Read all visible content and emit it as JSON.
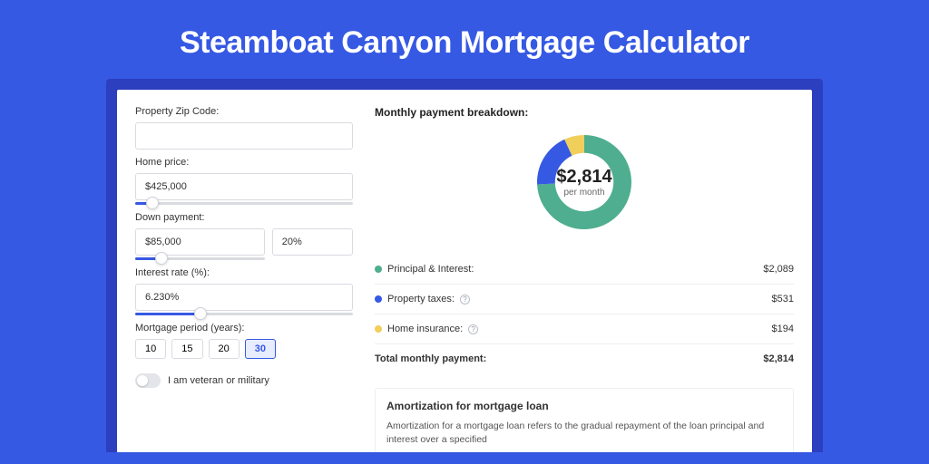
{
  "title": "Steamboat Canyon Mortgage Calculator",
  "form": {
    "zip_label": "Property Zip Code:",
    "zip_value": "",
    "home_price_label": "Home price:",
    "home_price_value": "$425,000",
    "down_payment_label": "Down payment:",
    "down_payment_value": "$85,000",
    "down_payment_pct": "20%",
    "rate_label": "Interest rate (%):",
    "rate_value": "6.230%",
    "period_label": "Mortgage period (years):",
    "periods": [
      "10",
      "15",
      "20",
      "30"
    ],
    "period_selected_index": 3,
    "veteran_label": "I am veteran or military",
    "sliders": {
      "home_price_pct": 8,
      "down_payment_pct": 20,
      "rate_pct": 30
    }
  },
  "breakdown": {
    "title": "Monthly payment breakdown:",
    "center_value": "$2,814",
    "center_label": "per month",
    "items": [
      {
        "label": "Principal & Interest:",
        "value": "$2,089",
        "color": "#4eae8f",
        "help": false
      },
      {
        "label": "Property taxes:",
        "value": "$531",
        "color": "#3659e3",
        "help": true
      },
      {
        "label": "Home insurance:",
        "value": "$194",
        "color": "#f0cf5b",
        "help": true
      }
    ],
    "total_label": "Total monthly payment:",
    "total_value": "$2,814"
  },
  "chart_data": {
    "type": "pie",
    "title": "Monthly payment breakdown",
    "series": [
      {
        "name": "Principal & Interest",
        "value": 2089,
        "color": "#4eae8f"
      },
      {
        "name": "Property taxes",
        "value": 531,
        "color": "#3659e3"
      },
      {
        "name": "Home insurance",
        "value": 194,
        "color": "#f0cf5b"
      }
    ],
    "total": 2814,
    "donut_inner_radius_ratio": 0.62
  },
  "amortization": {
    "title": "Amortization for mortgage loan",
    "text": "Amortization for a mortgage loan refers to the gradual repayment of the loan principal and interest over a specified"
  }
}
